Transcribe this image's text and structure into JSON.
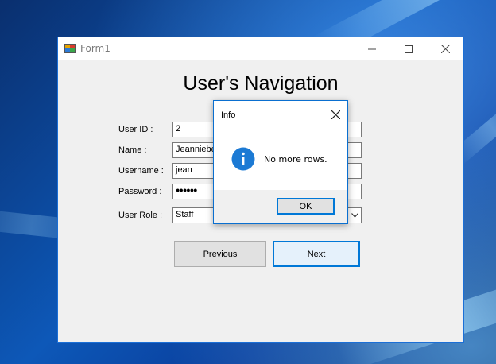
{
  "window": {
    "title": "Form1",
    "minimize": "—",
    "maximize": "☐",
    "close": "✕"
  },
  "form": {
    "heading": "User's Navigation",
    "fields": {
      "user_id": {
        "label": "User ID :",
        "value": "2"
      },
      "name": {
        "label": "Name :",
        "value": "Jeanniebe"
      },
      "username": {
        "label": "Username :",
        "value": "jean"
      },
      "password": {
        "label": "Password :",
        "value": "●●●●●●"
      },
      "user_role": {
        "label": "User Role :",
        "value": "Staff"
      }
    },
    "buttons": {
      "previous": "Previous",
      "next": "Next"
    }
  },
  "dialog": {
    "title": "Info",
    "message": "No more rows.",
    "ok": "OK",
    "icon": "info-icon"
  },
  "colors": {
    "accent": "#0078d7",
    "window_bg": "#f0f0f0",
    "info_icon": "#1c7ad4"
  }
}
